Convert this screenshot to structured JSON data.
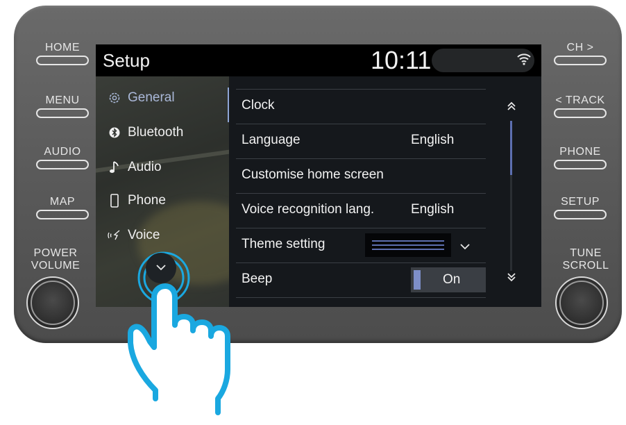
{
  "hardware": {
    "left_buttons": [
      "HOME",
      "MENU",
      "AUDIO",
      "MAP"
    ],
    "right_buttons": [
      "CH >",
      "< TRACK",
      "PHONE",
      "SETUP"
    ],
    "left_knob_label_1": "POWER",
    "left_knob_label_2": "VOLUME",
    "right_knob_label_1": "TUNE",
    "right_knob_label_2": "SCROLL"
  },
  "header": {
    "title": "Setup",
    "time": "10:11",
    "status_icon": "wifi-icon"
  },
  "sidebar": {
    "items": [
      {
        "label": "General",
        "icon": "gear-icon",
        "selected": true
      },
      {
        "label": "Bluetooth",
        "icon": "bluetooth-icon",
        "selected": false
      },
      {
        "label": "Audio",
        "icon": "music-note-icon",
        "selected": false
      },
      {
        "label": "Phone",
        "icon": "phone-icon",
        "selected": false
      },
      {
        "label": "Voice",
        "icon": "voice-icon",
        "selected": false
      }
    ],
    "more_button_icon": "chevron-down-icon"
  },
  "settings": {
    "rows": [
      {
        "label": "Clock",
        "value": ""
      },
      {
        "label": "Language",
        "value": "English"
      },
      {
        "label": "Customise home screen",
        "value": ""
      },
      {
        "label": "Voice recognition lang.",
        "value": "English"
      },
      {
        "label": "Theme setting",
        "value": ""
      },
      {
        "label": "Beep",
        "value": "On"
      }
    ]
  },
  "colors": {
    "accent": "#7d8ec8",
    "touch_hint": "#1aa8e0"
  }
}
